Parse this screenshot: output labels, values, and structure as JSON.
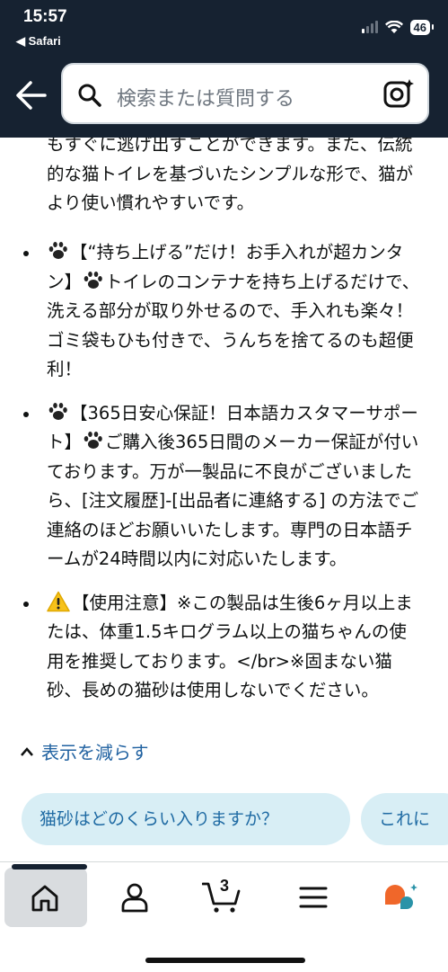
{
  "status_bar": {
    "time": "15:57",
    "back_app": "◀ Safari",
    "battery": "46"
  },
  "search": {
    "placeholder": "検索または質問する"
  },
  "content": {
    "top_paragraph": "もすぐに逃げ出すことができます。また、伝統的な猫トイレを基づいたシンプルな形で、猫がより使い慣れやすいです。",
    "bullets": [
      {
        "icon": "paw-icon",
        "text": "【“持ち上げる”だけ！お手入れが超カンタン】",
        "text2": "トイレのコンテナを持ち上げるだけで、洗える部分が取り外せるので、手入れも楽々！ゴミ袋もひも付きで、うんちを捨てるのも超便利！"
      },
      {
        "icon": "paw-icon",
        "text": "【365日安心保証！日本語カスタマーサポート】",
        "text2": "ご購入後365日間のメーカー保証が付いております。万が一製品に不良がございましたら、[注文履歴]-[出品者に連絡する] の方法でご連絡のほどお願いいたします。専門の日本語チームが24時間以内に対応いたします。"
      },
      {
        "icon": "warning-icon",
        "text": "【使用注意】※この製品は生後6ヶ月以上または、体重1.5キログラム以上の猫ちゃんの使用を推奨しております。</br>※固まない猫砂、長めの猫砂は使用しないでください。"
      }
    ],
    "show_less": "表示を減らす",
    "chips": [
      "猫砂はどのくらい入りますか？",
      "これに"
    ]
  },
  "nav": {
    "items": [
      "home-icon",
      "account-icon",
      "cart-icon",
      "menu-icon",
      "rufus-icon"
    ],
    "cart_count": "3"
  },
  "colors": {
    "header_bg": "#162231",
    "link": "#2162a1",
    "chip_bg": "#d8eef5"
  }
}
